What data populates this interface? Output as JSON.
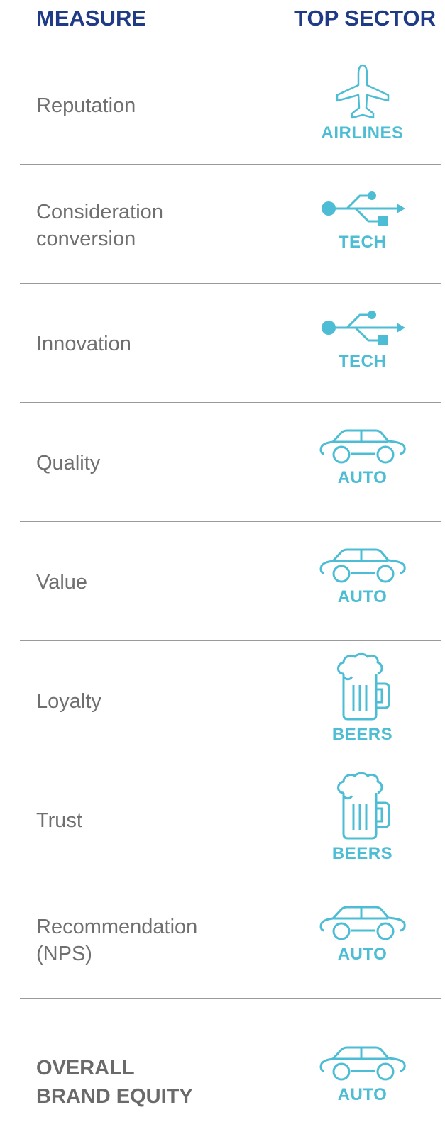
{
  "header": {
    "measure": "MEASURE",
    "top_sector": "TOP SECTOR"
  },
  "accent_color": "#4cbdd4",
  "header_color": "#1f3a86",
  "rows": [
    {
      "measure_lines": [
        "Reputation"
      ],
      "sector": "AIRLINES",
      "icon": "airplane-icon"
    },
    {
      "measure_lines": [
        "Consideration",
        "conversion"
      ],
      "sector": "TECH",
      "icon": "usb-icon"
    },
    {
      "measure_lines": [
        "Innovation"
      ],
      "sector": "TECH",
      "icon": "usb-icon"
    },
    {
      "measure_lines": [
        "Quality"
      ],
      "sector": "AUTO",
      "icon": "car-icon"
    },
    {
      "measure_lines": [
        "Value"
      ],
      "sector": "AUTO",
      "icon": "car-icon"
    },
    {
      "measure_lines": [
        "Loyalty"
      ],
      "sector": "BEERS",
      "icon": "beer-mug-icon"
    },
    {
      "measure_lines": [
        "Trust"
      ],
      "sector": "BEERS",
      "icon": "beer-mug-icon"
    },
    {
      "measure_lines": [
        "Recommendation",
        "(NPS)"
      ],
      "sector": "AUTO",
      "icon": "car-icon"
    },
    {
      "measure_lines": [
        "OVERALL",
        "BRAND EQUITY"
      ],
      "sector": "AUTO",
      "icon": "car-icon"
    }
  ]
}
